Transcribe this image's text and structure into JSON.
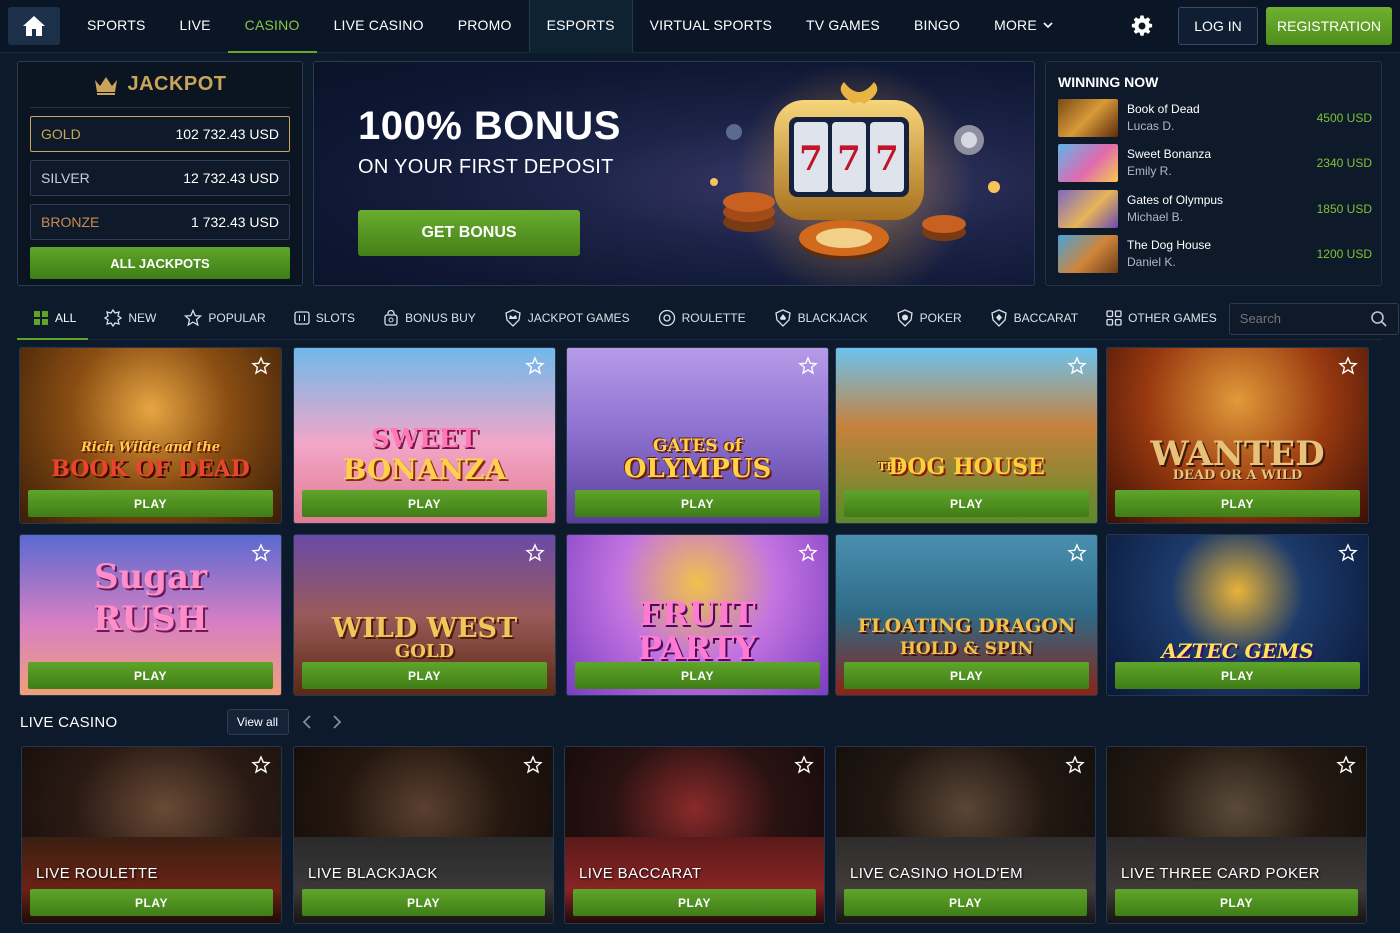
{
  "nav": {
    "items": [
      {
        "label": "SPORTS"
      },
      {
        "label": "LIVE"
      },
      {
        "label": "CASINO"
      },
      {
        "label": "LIVE CASINO"
      },
      {
        "label": "PROMO"
      },
      {
        "label": "ESPORTS"
      },
      {
        "label": "VIRTUAL SPORTS"
      },
      {
        "label": "TV GAMES"
      },
      {
        "label": "BINGO"
      },
      {
        "label": "MORE"
      }
    ],
    "active": "CASINO",
    "login": "LOG IN",
    "register": "REGISTRATION"
  },
  "jackpot": {
    "title": "JACKPOT",
    "rows": [
      {
        "label": "GOLD",
        "value": "102 732.43 USD"
      },
      {
        "label": "SILVER",
        "value": "12 732.43 USD"
      },
      {
        "label": "BRONZE",
        "value": "1 732.43 USD"
      }
    ],
    "all_button": "ALL JACKPOTS"
  },
  "banner": {
    "title": "100% BONUS",
    "subtitle": "ON YOUR FIRST DEPOSIT",
    "button": "GET BONUS"
  },
  "winning": {
    "title": "WINNING NOW",
    "items": [
      {
        "game": "Book of Dead",
        "user": "Lucas D.",
        "amount": "4500 USD"
      },
      {
        "game": "Sweet Bonanza",
        "user": "Emily R.",
        "amount": "2340 USD"
      },
      {
        "game": "Gates of Olympus",
        "user": "Michael B.",
        "amount": "1850 USD"
      },
      {
        "game": "The Dog House",
        "user": "Daniel K.",
        "amount": "1200 USD"
      }
    ]
  },
  "filters": {
    "items": [
      {
        "label": "ALL",
        "icon": "grid-icon"
      },
      {
        "label": "NEW",
        "icon": "badge-icon"
      },
      {
        "label": "POPULAR",
        "icon": "star-icon"
      },
      {
        "label": "SLOTS",
        "icon": "slot-icon"
      },
      {
        "label": "BONUS BUY",
        "icon": "bag-icon"
      },
      {
        "label": "JACKPOT GAMES",
        "icon": "crown-shield-icon"
      },
      {
        "label": "ROULETTE",
        "icon": "roulette-icon"
      },
      {
        "label": "BLACKJACK",
        "icon": "spade-shield-icon"
      },
      {
        "label": "POKER",
        "icon": "poker-icon"
      },
      {
        "label": "BACCARAT",
        "icon": "baccarat-icon"
      },
      {
        "label": "OTHER GAMES",
        "icon": "squares-icon"
      }
    ],
    "search_placeholder": "Search"
  },
  "games": {
    "play_label": "PLAY",
    "row1": [
      {
        "title_line1": "Rich Wilde and the",
        "title_line2": "BOOK OF DEAD"
      },
      {
        "title_line1": "SWEET",
        "title_line2": "BONANZA"
      },
      {
        "title_line1": "GATES of",
        "title_line2": "OLYMPUS"
      },
      {
        "title_line1": "THE",
        "title_line2": "DOG HOUSE"
      },
      {
        "title_line1": "WANTED",
        "title_line2": "DEAD OR A WILD"
      }
    ],
    "row2": [
      {
        "title_line1": "Sugar",
        "title_line2": "RUSH"
      },
      {
        "title_line1": "WILD WEST",
        "title_line2": "GOLD"
      },
      {
        "title_line1": "FRUIT",
        "title_line2": "PARTY"
      },
      {
        "title_line1": "FLOATING DRAGON",
        "title_line2": "HOLD & SPIN"
      },
      {
        "title_line1": "",
        "title_line2": "AZTEC GEMS"
      }
    ]
  },
  "live": {
    "title": "LIVE CASINO",
    "view_all": "View all",
    "play_label": "PLAY",
    "items": [
      {
        "name": "LIVE ROULETTE"
      },
      {
        "name": "LIVE BLACKJACK"
      },
      {
        "name": "LIVE BACCARAT"
      },
      {
        "name": "LIVE CASINO HOLD'EM"
      },
      {
        "name": "LIVE THREE CARD POKER"
      }
    ]
  },
  "colors": {
    "accent_green": "#5ea52a",
    "nav_active": "#8cc63f",
    "gold": "#c9a45a",
    "background": "#0d1a2b"
  }
}
